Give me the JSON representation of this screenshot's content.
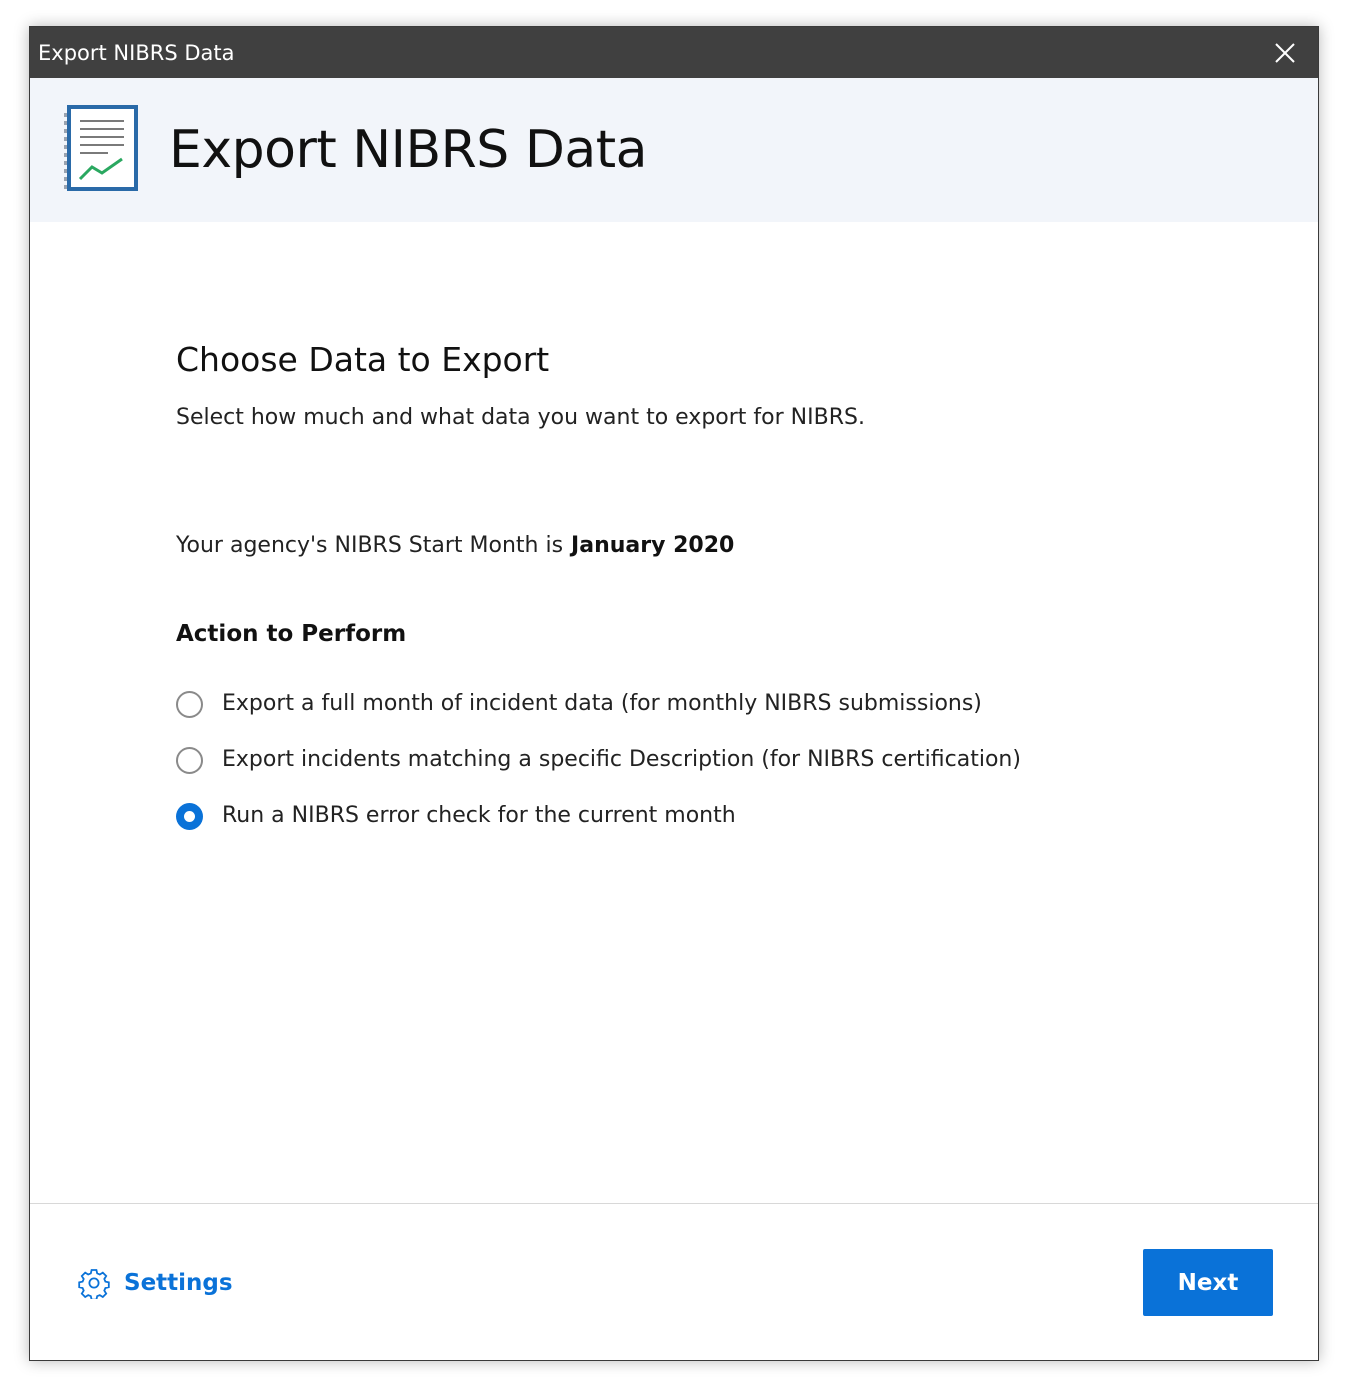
{
  "window": {
    "title": "Export NIBRS Data",
    "close_icon": "close-icon"
  },
  "header": {
    "title": "Export NIBRS Data",
    "icon": "report-chart-icon"
  },
  "main": {
    "heading": "Choose Data to Export",
    "subheading": "Select how much and what data you want to export for NIBRS.",
    "start_month_label": "Your agency's NIBRS Start Month is",
    "start_month_value": "January 2020",
    "action_heading": "Action to Perform",
    "options": [
      {
        "label": "Export a full month of incident data (for monthly NIBRS submissions)",
        "selected": false
      },
      {
        "label": "Export incidents matching a specific Description (for NIBRS certification)",
        "selected": false
      },
      {
        "label": "Run a NIBRS error check for the current month",
        "selected": true
      }
    ]
  },
  "footer": {
    "settings_label": "Settings",
    "settings_icon": "gear-icon",
    "next_label": "Next"
  },
  "colors": {
    "accent": "#0a72d8",
    "titlebar": "#404040",
    "header_band": "#f2f5fa"
  }
}
